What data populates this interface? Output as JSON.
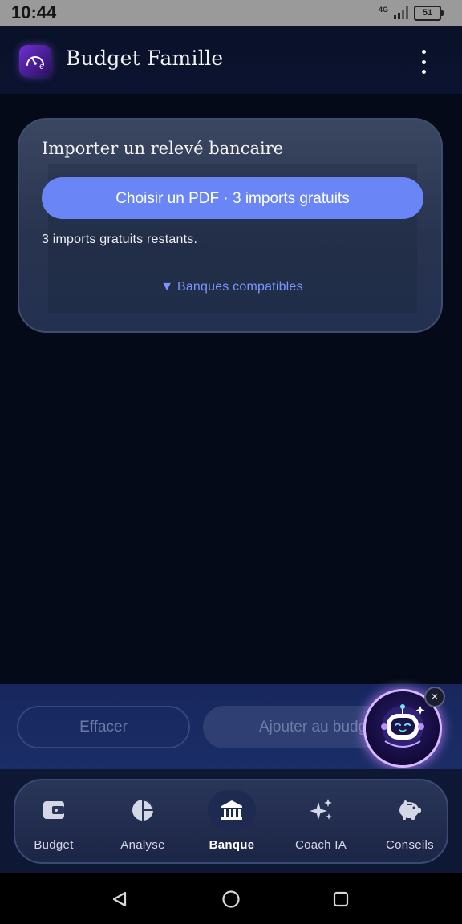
{
  "status_bar": {
    "time": "10:44",
    "network": "4G",
    "battery": "51"
  },
  "app_bar": {
    "title": "Budget Famille",
    "logo_icon": "gauge-euro-icon",
    "menu_icon": "more-vert-icon"
  },
  "import_card": {
    "title": "Importer un relevé bancaire",
    "pdf_button_label": "Choisir un PDF · 3 imports gratuits",
    "remaining_text": "3 imports gratuits restants.",
    "banks_toggle_label": "▼ Banques compatibles"
  },
  "actions": {
    "clear_label": "Effacer",
    "add_label": "Ajouter au budget"
  },
  "assistant": {
    "icon": "robot-assistant-icon",
    "close_symbol": "×"
  },
  "bottom_nav": {
    "items": [
      {
        "label": "Budget",
        "icon": "wallet-icon",
        "active": false
      },
      {
        "label": "Analyse",
        "icon": "pie-chart-icon",
        "active": false
      },
      {
        "label": "Banque",
        "icon": "bank-icon",
        "active": true
      },
      {
        "label": "Coach IA",
        "icon": "sparkles-icon",
        "active": false
      },
      {
        "label": "Conseils",
        "icon": "piggy-bank-icon",
        "active": false
      }
    ]
  },
  "colors": {
    "background": "#040a17",
    "accent": "#6a86f6",
    "link": "#7b95ff",
    "card": "#2f3b56"
  }
}
